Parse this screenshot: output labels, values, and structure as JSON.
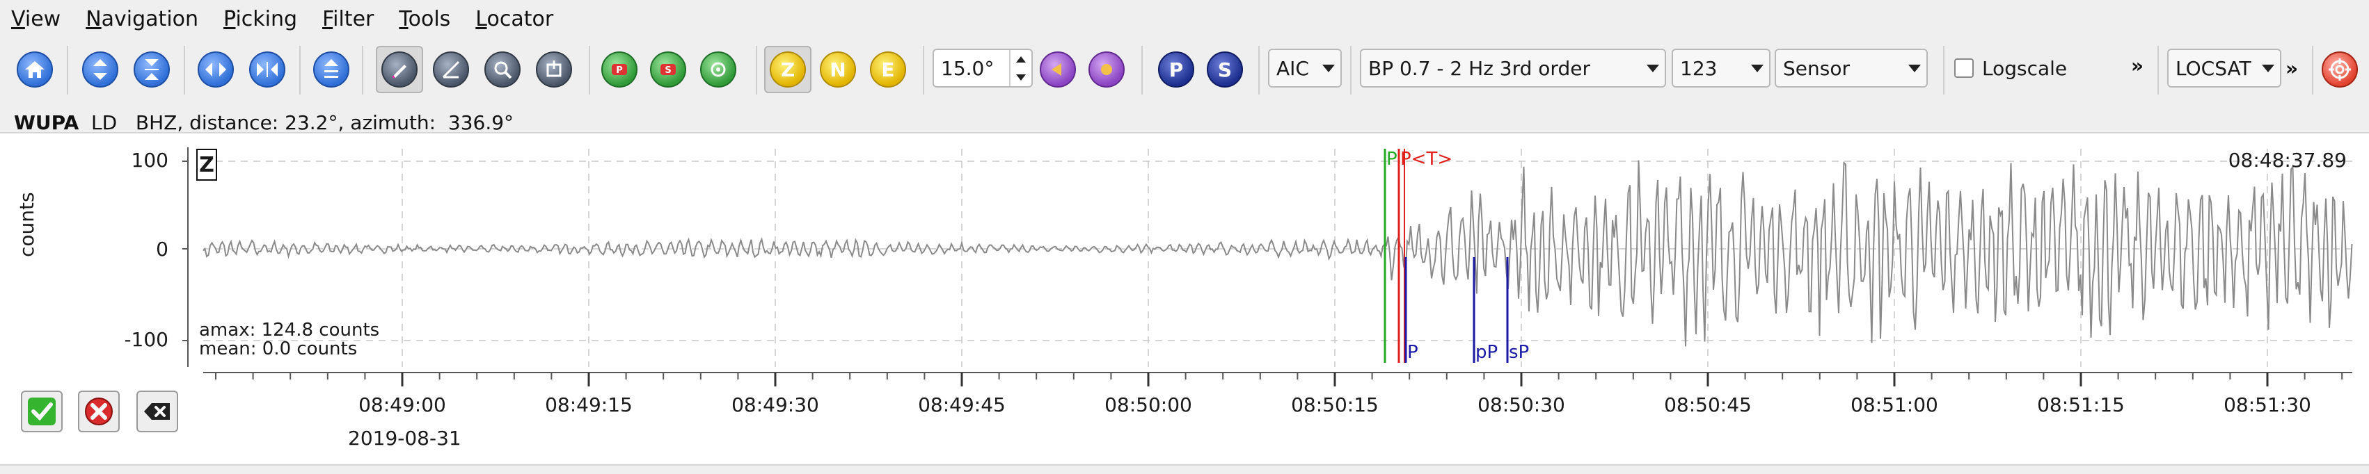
{
  "menu": [
    {
      "pre": "",
      "mn": "V",
      "post": "iew"
    },
    {
      "pre": "",
      "mn": "N",
      "post": "avigation"
    },
    {
      "pre": "",
      "mn": "P",
      "post": "icking"
    },
    {
      "pre": "",
      "mn": "F",
      "post": "ilter"
    },
    {
      "pre": "",
      "mn": "T",
      "post": "ools"
    },
    {
      "pre": "",
      "mn": "L",
      "post": "ocator"
    }
  ],
  "toolbar": {
    "component_buttons": {
      "z": "Z",
      "n": "N",
      "e": "E"
    },
    "phase_buttons": {
      "p": "P",
      "s": "S"
    },
    "spin_value": "15.0°",
    "picker_method": "AIC",
    "filter": "BP 0.7 - 2 Hz  3rd order",
    "channel_mode": "123",
    "unit_mode": "Sensor",
    "logscale_label": "Logscale",
    "locator": "LOCSAT",
    "overflow_chevron": "»"
  },
  "trace": {
    "header": {
      "station": "WUPA",
      "rest": "  LD   BHZ, distance: 23.2°, azimuth:  336.9°"
    },
    "component": "Z",
    "end_time": "08:48:37.89",
    "amax": "amax: 124.8 counts",
    "mean": "mean: 0.0 counts",
    "ylabel": "counts",
    "y_ticks": [
      "100",
      "0",
      "-100"
    ],
    "x_ticks": [
      "08:49:00",
      "08:49:15",
      "08:49:30",
      "08:49:45",
      "08:50:00",
      "08:50:15",
      "08:50:30",
      "08:50:45",
      "08:51:00",
      "08:51:15",
      "08:51:30"
    ],
    "date": "2019-08-31",
    "picks": [
      {
        "label": "P",
        "color": "#22aa22"
      },
      {
        "label": "P<T>",
        "color": "#e0201a"
      },
      {
        "label": "P",
        "color": "#1a1aa6"
      },
      {
        "label": "pP",
        "color": "#1a1aa6"
      },
      {
        "label": "sP",
        "color": "#1a1aa6"
      }
    ]
  },
  "colors": {
    "waveform": "#8a8a8a",
    "grid": "#c8c8c8",
    "theoretical": "#1a1aa6",
    "manual_pick": "#22aa22",
    "automatic_pick": "#e0201a"
  },
  "icons": [
    "home-icon",
    "zoom-in-y-icon",
    "zoom-out-y-icon",
    "zoom-in-x-icon",
    "zoom-out-x-icon",
    "zoom-reset-icon",
    "pick-tool-icon",
    "measure-icon",
    "alignment-icon",
    "align-pick-icon",
    "pick-p-icon",
    "pick-s-icon",
    "relocate-icon",
    "rotate-icon",
    "filter-icon",
    "pick-p-phase-icon",
    "pick-s-phase-icon",
    "target-icon",
    "accept-icon",
    "reject-icon",
    "close-icon"
  ]
}
